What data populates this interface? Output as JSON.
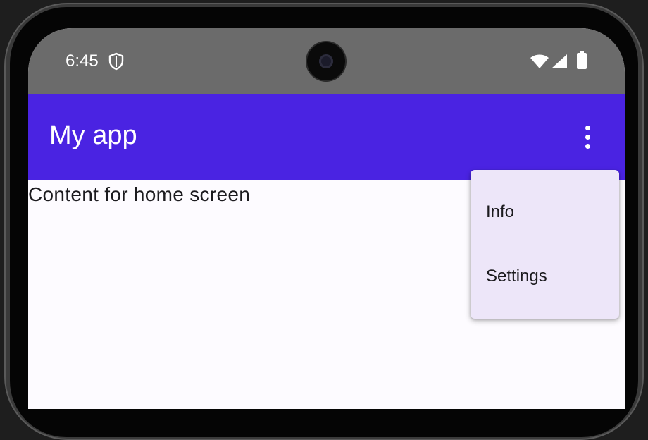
{
  "status_bar": {
    "time": "6:45",
    "icons": [
      "shield-icon",
      "wifi-icon",
      "signal-icon",
      "battery-icon"
    ]
  },
  "app_bar": {
    "title": "My app",
    "overflow_icon": "more-vert-icon",
    "color": "#4a23e2"
  },
  "content": {
    "text": "Content for home screen"
  },
  "menu": {
    "items": [
      {
        "label": "Info"
      },
      {
        "label": "Settings"
      }
    ],
    "background": "#ede6f9"
  }
}
